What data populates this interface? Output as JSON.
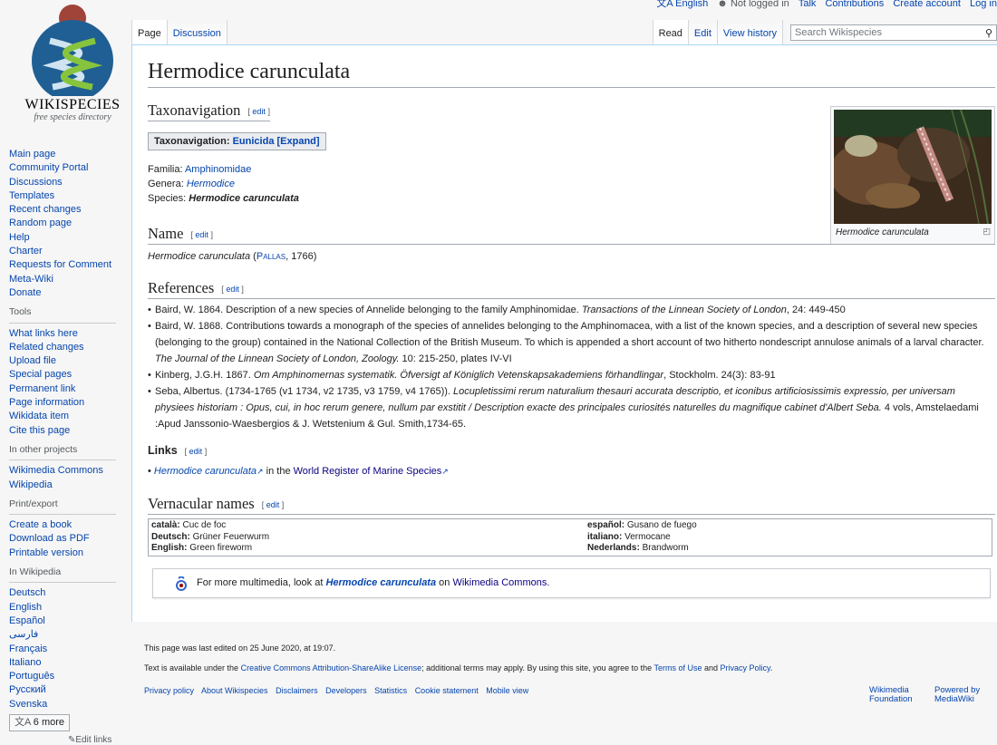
{
  "personal": {
    "language": "English",
    "not_logged_in": "Not logged in",
    "talk": "Talk",
    "contributions": "Contributions",
    "create_account": "Create account",
    "log_in": "Log in"
  },
  "logo": {
    "wordmark": "WIKISPECIES",
    "tagline": "free species directory"
  },
  "tabs": {
    "left": [
      "Page",
      "Discussion"
    ],
    "right": [
      "Read",
      "Edit",
      "View history"
    ],
    "search_placeholder": "Search Wikispecies"
  },
  "sidebar": {
    "nav": [
      "Main page",
      "Community Portal",
      "Discussions",
      "Templates",
      "Recent changes",
      "Random page",
      "Help",
      "Charter",
      "Requests for Comment",
      "Meta-Wiki",
      "Donate"
    ],
    "tools_heading": "Tools",
    "tools": [
      "What links here",
      "Related changes",
      "Upload file",
      "Special pages",
      "Permanent link",
      "Page information",
      "Wikidata item",
      "Cite this page"
    ],
    "other_heading": "In other projects",
    "other": [
      "Wikimedia Commons",
      "Wikipedia"
    ],
    "print_heading": "Print/export",
    "print": [
      "Create a book",
      "Download as PDF",
      "Printable version"
    ],
    "wp_heading": "In Wikipedia",
    "languages": [
      "Deutsch",
      "English",
      "Español",
      "فارسی",
      "Français",
      "Italiano",
      "Português",
      "Русский",
      "Svenska"
    ],
    "more_languages": "6 more",
    "edit_links": "Edit links"
  },
  "article": {
    "title": "Hermodice carunculata",
    "edit": "edit",
    "taxonav_heading": "Taxonavigation",
    "taxobox": {
      "label": "Taxonavigation: ",
      "link": "Eunicida",
      "expand": "[Expand]"
    },
    "taxa": [
      {
        "rank": "Familia: ",
        "name": "Amphinomidae",
        "style": "link"
      },
      {
        "rank": "Genera: ",
        "name": "Hermodice",
        "style": "link-italic"
      },
      {
        "rank": "Species: ",
        "name": "Hermodice carunculata",
        "style": "bold-italic"
      }
    ],
    "image_caption": "Hermodice carunculata",
    "name_heading": "Name",
    "name_line": {
      "binomial": "Hermodice carunculata",
      "open": " (",
      "author": "Pallas",
      "year": ", 1766)"
    },
    "references_heading": "References",
    "references": [
      {
        "plain": "Baird, W. 1864. Description of a new species of Annelide belonging to the family Amphinomidae. ",
        "italic": "Transactions of the Linnean Society of London",
        "rest": ", 24: 449-450"
      },
      {
        "plain": "Baird, W. 1868. Contributions towards a monograph of the species of annelides belonging to the Amphinomacea, with a list of the known species, and a description of several new species (belonging to the group) contained in the National Collection of the British Museum. To which is appended a short account of two hitherto nondescript annulose animals of a larval character. ",
        "italic": "The Journal of the Linnean Society of London, Zoology.",
        "rest": " 10: 215-250, plates IV-VI"
      },
      {
        "plain": "Kinberg, J.G.H. 1867. ",
        "italic": "Om Amphinomernas systematik. Öfversigt af Königlich Vetenskapsakademiens förhandlingar",
        "rest": ", Stockholm. 24(3): 83-91"
      },
      {
        "plain": "Seba, Albertus. (1734-1765 (v1 1734, v2 1735, v3 1759, v4 1765)). ",
        "italic": "Locupletissimi rerum naturalium thesauri accurata descriptio, et iconibus artificiosissimis expressio, per universam physiees historiam : Opus, cui, in hoc rerum genere, nullum par exstitit / Description exacte des principales curiosités naturelles du magnifique cabinet d'Albert Seba.",
        "rest": " 4 vols, Amstelaedami :Apud Janssonio-Waesbergios & J. Wetstenium & Gul. Smith,1734-65."
      }
    ],
    "links_heading": "Links",
    "links_line": {
      "species": "Hermodice carunculata",
      "middle": " in the ",
      "register": "World Register of Marine Species"
    },
    "vernacular_heading": "Vernacular names",
    "vernacular": {
      "left": [
        {
          "lang": "català:",
          "name": " Cuc de foc"
        },
        {
          "lang": "Deutsch:",
          "name": " Grüner Feuerwurm"
        },
        {
          "lang": "English:",
          "name": " Green fireworm"
        }
      ],
      "right": [
        {
          "lang": "español:",
          "name": " Gusano de fuego"
        },
        {
          "lang": "italiano:",
          "name": " Vermocane"
        },
        {
          "lang": "Nederlands:",
          "name": " Brandworm"
        }
      ]
    },
    "commons": {
      "pre": "For more multimedia, look at ",
      "species": "Hermodice carunculata",
      "mid": " on ",
      "link": "Wikimedia Commons",
      "post": "."
    }
  },
  "footer": {
    "last_edited": "This page was last edited on 25 June 2020, at 19:07.",
    "license": {
      "pre": "Text is available under the ",
      "link": "Creative Commons Attribution-ShareAlike License",
      "mid": "; additional terms may apply. By using this site, you agree to the ",
      "terms": "Terms of Use",
      "and": " and ",
      "privacy": "Privacy Policy",
      "end": "."
    },
    "links": [
      "Privacy policy",
      "About Wikispecies",
      "Disclaimers",
      "Developers",
      "Statistics",
      "Cookie statement",
      "Mobile view"
    ],
    "badge1": [
      "Wikimedia",
      "Foundation"
    ],
    "badge2": [
      "Powered by",
      "MediaWiki"
    ]
  }
}
